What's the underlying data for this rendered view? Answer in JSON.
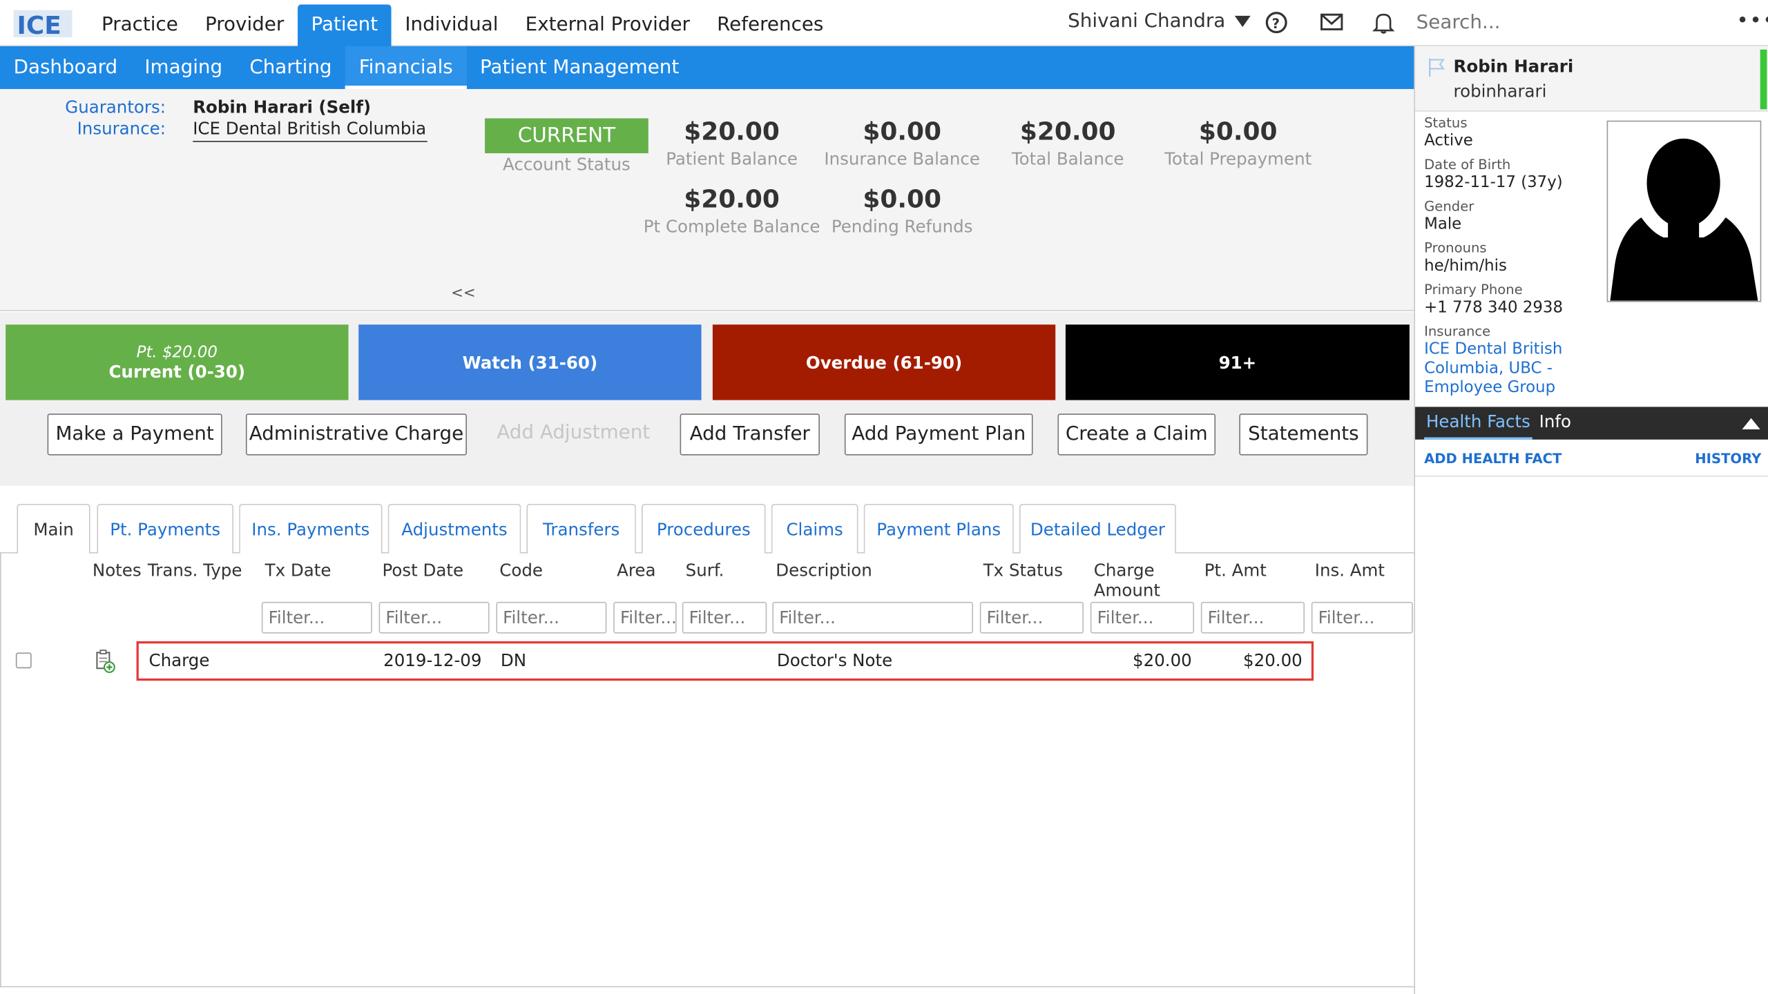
{
  "logo": {
    "text": "ICE"
  },
  "topnav": {
    "items": [
      "Practice",
      "Provider",
      "Patient",
      "Individual",
      "External Provider",
      "References"
    ],
    "active": "Patient"
  },
  "user": {
    "name": "Shivani Chandra"
  },
  "search": {
    "placeholder": "Search..."
  },
  "subnav": {
    "items": [
      "Dashboard",
      "Imaging",
      "Charting",
      "Financials",
      "Patient Management"
    ],
    "active": "Financials"
  },
  "summary": {
    "guarantors_label": "Guarantors:",
    "guarantors_value": "Robin Harari (Self)",
    "insurance_label": "Insurance:",
    "insurance_value": "ICE Dental British Columbia, ...",
    "account_status": "CURRENT",
    "account_status_label": "Account Status",
    "patient_balance": "$20.00",
    "patient_balance_label": "Patient Balance",
    "insurance_balance": "$0.00",
    "insurance_balance_label": "Insurance Balance",
    "total_balance": "$20.00",
    "total_balance_label": "Total Balance",
    "total_prepayment": "$0.00",
    "total_prepayment_label": "Total Prepayment",
    "pt_complete_balance": "$20.00",
    "pt_complete_balance_label": "Pt Complete Balance",
    "pending_refunds": "$0.00",
    "pending_refunds_label": "Pending Refunds",
    "collapse": "<<"
  },
  "aging": {
    "current_sub": "Pt. $20.00",
    "current": "Current (0-30)",
    "watch": "Watch (31-60)",
    "overdue": "Overdue (61-90)",
    "over91": "91+",
    "colors": {
      "current": "#66b04a",
      "watch": "#3c7fdc",
      "overdue": "#a41c00",
      "over91": "#000000"
    }
  },
  "actions": {
    "make_payment": "Make a Payment",
    "administrative_charge": "Administrative Charge",
    "add_adjustment": "Add Adjustment",
    "add_transfer": "Add Transfer",
    "add_payment_plan": "Add Payment Plan",
    "create_claim": "Create a Claim",
    "statements": "Statements"
  },
  "tabs": [
    "Main",
    "Pt. Payments",
    "Ins. Payments",
    "Adjustments",
    "Transfers",
    "Procedures",
    "Claims",
    "Payment Plans",
    "Detailed Ledger"
  ],
  "table": {
    "columns": [
      "Notes",
      "Trans. Type",
      "Tx Date",
      "Post Date",
      "Code",
      "Area",
      "Surf.",
      "Description",
      "Tx Status",
      "Charge Amount",
      "Pt. Amt",
      "Ins. Amt"
    ],
    "filter_placeholder": "Filter...",
    "rows": [
      {
        "trans_type": "Charge",
        "tx_date": "",
        "post_date": "2019-12-09",
        "code": "DN",
        "area": "",
        "surf": "",
        "description": "Doctor's Note",
        "tx_status": "",
        "charge_amount": "$20.00",
        "pt_amt": "$20.00",
        "ins_amt": ""
      }
    ]
  },
  "patient": {
    "name": "Robin Harari",
    "username": "robinharari",
    "status_label": "Status",
    "status": "Active",
    "dob_label": "Date of Birth",
    "dob": "1982-11-17 (37y)",
    "gender_label": "Gender",
    "gender": "Male",
    "pronouns_label": "Pronouns",
    "pronouns": "he/him/his",
    "phone_label": "Primary Phone",
    "phone": "+1 778 340 2938",
    "insurance_label": "Insurance",
    "insurance": "ICE Dental British Columbia, UBC - Employee Group"
  },
  "health_facts": {
    "tabs": [
      "Health Facts",
      "Info"
    ],
    "add": "ADD HEALTH FACT",
    "history": "HISTORY"
  }
}
